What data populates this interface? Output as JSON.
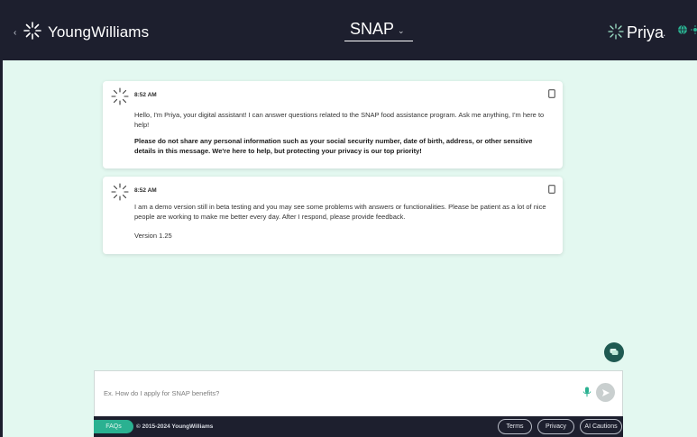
{
  "header": {
    "back_glyph": "‹",
    "brand": "YoungWilliams",
    "program": "SNAP",
    "program_chevron": "⌄",
    "assistant_name": "Priya",
    "assistant_dot": "."
  },
  "messages": [
    {
      "time": "8:52 AM",
      "paragraphs": [
        "Hello, I'm Priya, your digital assistant! I can answer questions related to the SNAP food assistance program. Ask me anything, I'm here to help!",
        "Please do not share any personal information such as your social security number, date of birth, address, or other sensitive details in this message. We're here to help, but protecting your privacy is our top priority!"
      ]
    },
    {
      "time": "8:52 AM",
      "paragraphs": [
        "I am a demo version still in beta testing and you may see some problems with answers or functionalities. Please be patient as a lot of nice people are working to make me better every day. After I respond, please provide feedback.",
        "Version 1.25"
      ]
    }
  ],
  "input": {
    "value": "",
    "placeholder": "Ex. How do I apply for SNAP benefits?"
  },
  "footer": {
    "faqs": "FAQs",
    "copyright": "© 2015-2024 YoungWilliams",
    "terms": "Terms",
    "privacy": "Privacy",
    "ai_cautions": "AI Cautions"
  },
  "icons": {
    "logo": "youngwilliams-logo-icon",
    "avatar": "priya-avatar-icon",
    "copy": "copy-icon",
    "chat": "chat-bubble-icon",
    "mic": "microphone-icon",
    "send": "send-icon",
    "globe": "globe-icon",
    "sun": "sun-icon"
  },
  "colors": {
    "header_bg": "#1d1f2e",
    "page_bg": "#e3f8f0",
    "accent": "#2ab191",
    "fab": "#1f5a52"
  }
}
